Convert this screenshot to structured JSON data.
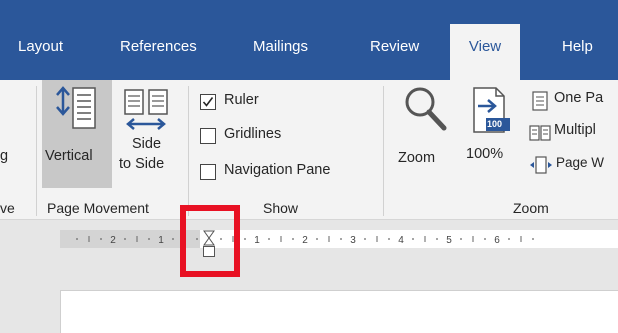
{
  "tabs": [
    {
      "label": "Layout"
    },
    {
      "label": "References"
    },
    {
      "label": "Mailings"
    },
    {
      "label": "Review"
    },
    {
      "label": "View"
    },
    {
      "label": "Help"
    }
  ],
  "active_tab": "View",
  "ribbon": {
    "views_partial_label": "g",
    "views_group_partial": "ve",
    "page_movement": {
      "vertical_label": "Vertical",
      "side_label_line1": "Side",
      "side_label_line2": "to Side",
      "group_label": "Page Movement"
    },
    "show": {
      "ruler_label": "Ruler",
      "ruler_checked": true,
      "gridlines_label": "Gridlines",
      "gridlines_checked": false,
      "nav_pane_label": "Navigation Pane",
      "nav_pane_checked": false,
      "group_label": "Show"
    },
    "zoom": {
      "zoom_label": "Zoom",
      "percent_label": "100%",
      "percent_icon_text": "100",
      "one_page_label": "One Pa",
      "multiple_pages_label": "Multipl",
      "page_width_label": "Page W",
      "group_label": "Zoom"
    }
  },
  "ruler": {
    "labels": [
      "2",
      "1",
      "1",
      "2",
      "3",
      "4",
      "5",
      "6"
    ]
  },
  "colors": {
    "ribbon_blue": "#2b579a",
    "highlight_red": "#e81123",
    "selected_button": "#c8c8c8"
  }
}
